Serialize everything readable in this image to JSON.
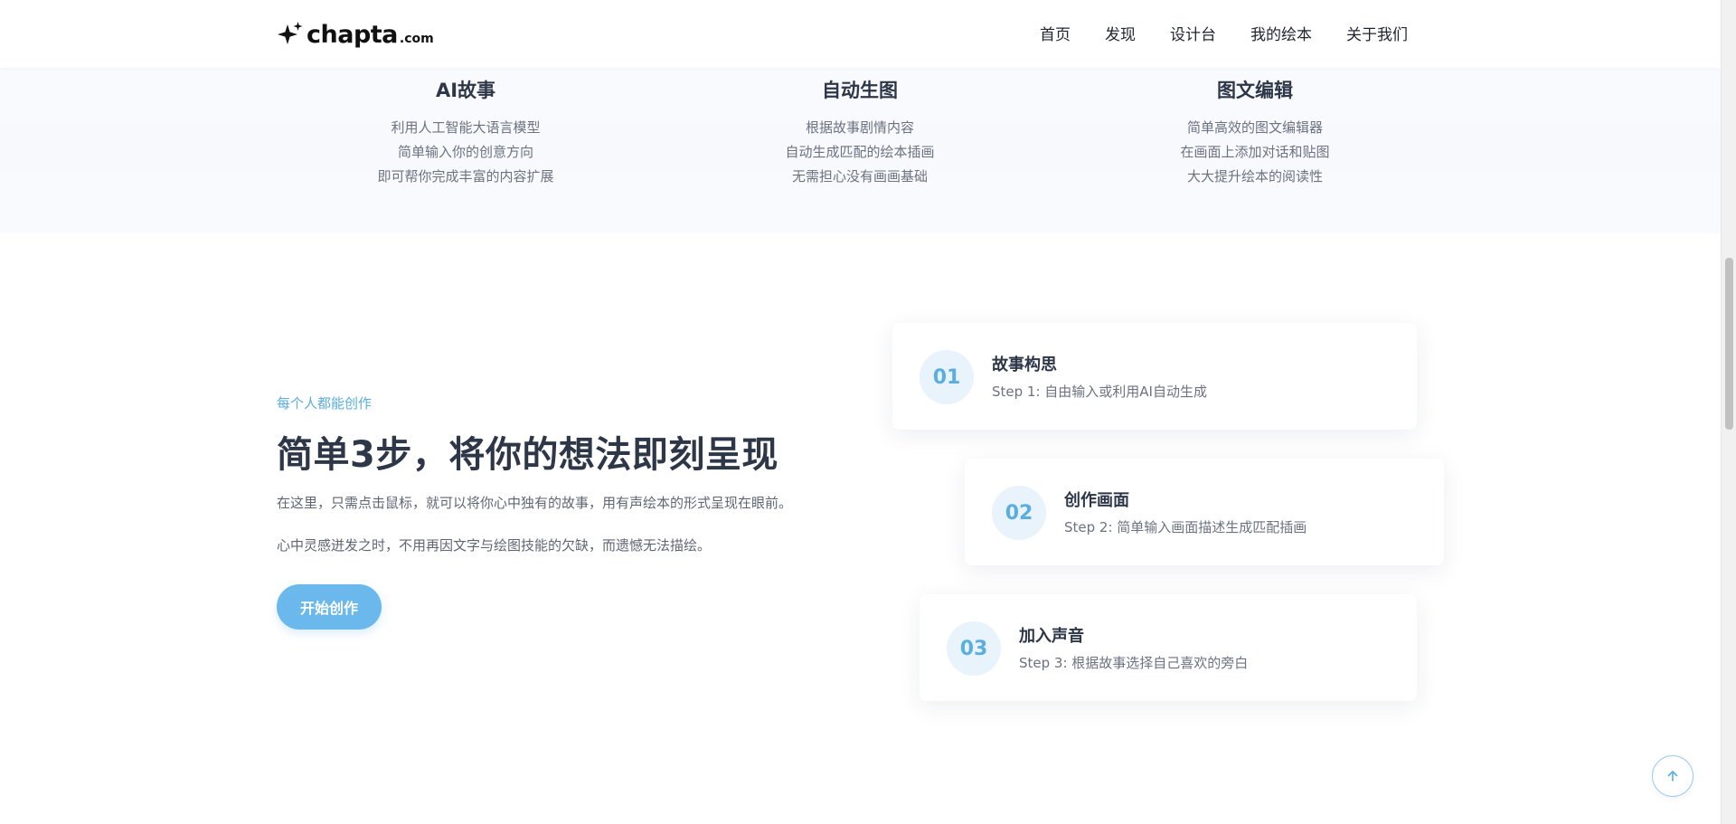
{
  "header": {
    "logo": {
      "name": "chapta",
      "tld": ".com"
    },
    "nav": [
      {
        "label": "首页"
      },
      {
        "label": "发现"
      },
      {
        "label": "设计台"
      },
      {
        "label": "我的绘本"
      },
      {
        "label": "关于我们"
      }
    ]
  },
  "features": [
    {
      "title": "AI故事",
      "lines": [
        "利用人工智能大语言模型",
        "简单输入你的创意方向",
        "即可帮你完成丰富的内容扩展"
      ]
    },
    {
      "title": "自动生图",
      "lines": [
        "根据故事剧情内容",
        "自动生成匹配的绘本插画",
        "无需担心没有画画基础"
      ]
    },
    {
      "title": "图文编辑",
      "lines": [
        "简单高效的图文编辑器",
        "在画面上添加对话和贴图",
        "大大提升绘本的阅读性"
      ]
    }
  ],
  "hero": {
    "kicker": "每个人都能创作",
    "headline": "简单3步，将你的想法即刻呈现",
    "paragraph_1": "在这里，只需点击鼠标，就可以将你心中独有的故事，用有声绘本的形式呈现在眼前。",
    "paragraph_2": "心中灵感迸发之时，不用再因文字与绘图技能的欠缺，而遗憾无法描绘。",
    "cta_label": "开始创作"
  },
  "steps": [
    {
      "number": "01",
      "title": "故事构思",
      "desc": "Step 1: 自由输入或利用AI自动生成"
    },
    {
      "number": "02",
      "title": "创作画面",
      "desc": "Step 2: 简单输入画面描述生成匹配插画"
    },
    {
      "number": "03",
      "title": "加入声音",
      "desc": "Step 3: 根据故事选择自己喜欢的旁白"
    }
  ],
  "colors": {
    "accent": "#6bb9ec",
    "accent_text": "#5aaee0",
    "badge_bg": "#e8f3fc",
    "heading": "#2d3748",
    "body": "#6b7280"
  },
  "icons": {
    "logo_mark": "sparkle-icon",
    "back_to_top": "arrow-up-icon"
  }
}
